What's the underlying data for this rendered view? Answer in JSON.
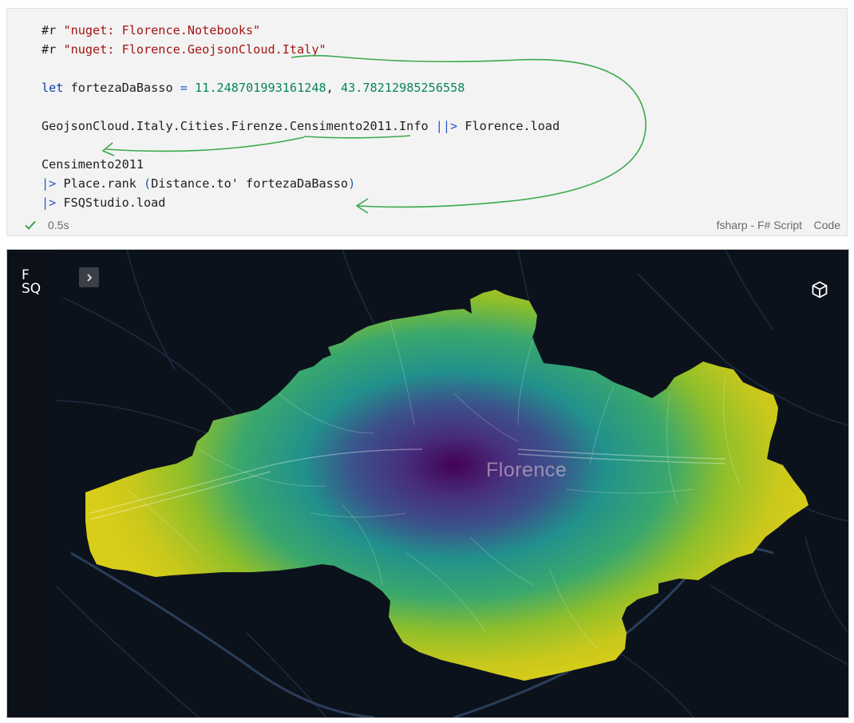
{
  "cell": {
    "code_lines": [
      {
        "tokens": [
          {
            "t": "#r ",
            "c": "pun"
          },
          {
            "t": "\"nuget: Florence.Notebooks\"",
            "c": "str"
          }
        ]
      },
      {
        "tokens": [
          {
            "t": "#r ",
            "c": "pun"
          },
          {
            "t": "\"nuget: Florence.GeojsonCloud.Italy\"",
            "c": "str"
          }
        ]
      },
      {
        "tokens": []
      },
      {
        "tokens": [
          {
            "t": "let",
            "c": "kw"
          },
          {
            "t": " fortezaDaBasso ",
            "c": "pun"
          },
          {
            "t": "=",
            "c": "op"
          },
          {
            "t": " ",
            "c": "pun"
          },
          {
            "t": "11.248701993161248",
            "c": "num"
          },
          {
            "t": ", ",
            "c": "pun"
          },
          {
            "t": "43.78212985256558",
            "c": "num"
          }
        ]
      },
      {
        "tokens": []
      },
      {
        "tokens": [
          {
            "t": "GeojsonCloud.Italy.Cities.Firenze.Censimento2011.Info ",
            "c": "pun"
          },
          {
            "t": "||>",
            "c": "op"
          },
          {
            "t": " Florence.load",
            "c": "pun"
          }
        ]
      },
      {
        "tokens": []
      },
      {
        "tokens": [
          {
            "t": "Censimento2011",
            "c": "pun"
          }
        ]
      },
      {
        "tokens": [
          {
            "t": "|>",
            "c": "op"
          },
          {
            "t": " Place.rank ",
            "c": "pun"
          },
          {
            "t": "(",
            "c": "op"
          },
          {
            "t": "Distance.to' fortezaDaBasso",
            "c": "pun"
          },
          {
            "t": ")",
            "c": "op"
          }
        ]
      },
      {
        "tokens": [
          {
            "t": "|>",
            "c": "op"
          },
          {
            "t": " FSQStudio.load",
            "c": "pun"
          }
        ]
      }
    ],
    "exec_time": "0.5s",
    "language": "fsharp - F# Script",
    "code_link": "Code"
  },
  "map": {
    "logo_line1": "F",
    "logo_line2": "SQ",
    "city_label": "Florence",
    "icons": {
      "expand": "chevron-right-icon",
      "view3d": "cube-icon",
      "status": "check-icon"
    }
  },
  "colors": {
    "annotation": "#3aaa4a",
    "check": "#2e9a3e",
    "map_bg": "#0c121c",
    "viridis": [
      "#440154",
      "#3b528b",
      "#21918c",
      "#5ec962",
      "#b5c51f",
      "#d8d318"
    ]
  }
}
